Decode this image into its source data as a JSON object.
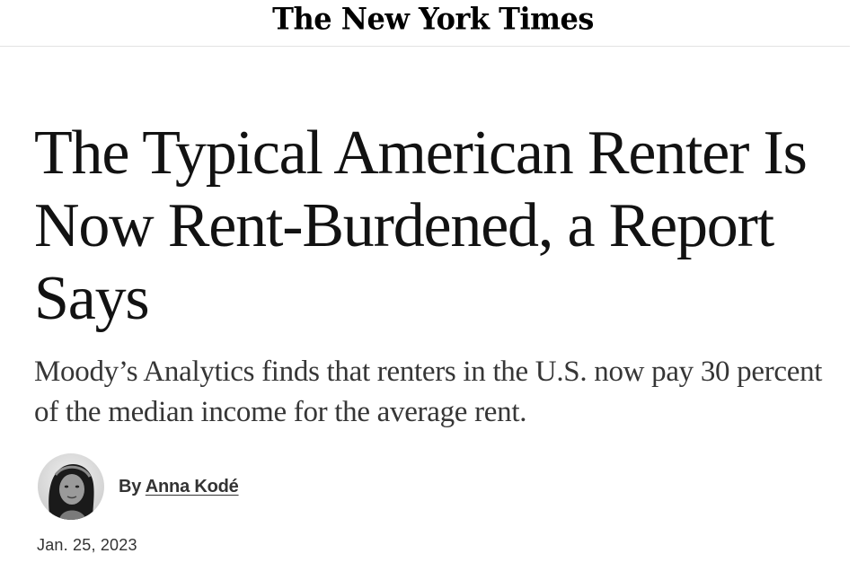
{
  "masthead": {
    "logo_text": "The New York Times"
  },
  "article": {
    "headline": "The Typical American Renter Is Now Rent-Burdened, a Report Says",
    "summary": "Moody’s Analytics finds that renters in the U.S. now pay 30 percent of the median income for the average rent.",
    "byline_prefix": "By",
    "author": "Anna Kodé",
    "date": "Jan. 25, 2023"
  },
  "colors": {
    "headline": "#121212",
    "summary": "#363636",
    "meta": "#333333",
    "rule": "#e2e2e2"
  }
}
